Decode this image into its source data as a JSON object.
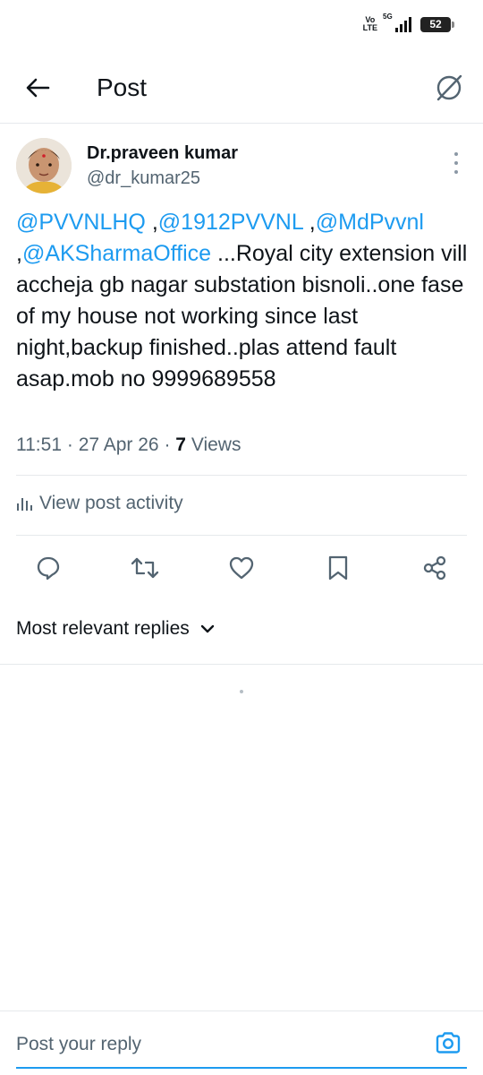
{
  "status_bar": {
    "volte_top": "Vo",
    "volte_bottom": "LTE",
    "network": "5G",
    "battery": "52"
  },
  "header": {
    "title": "Post",
    "back_icon": "arrow-left-icon",
    "grok_icon": "grok-icon"
  },
  "post": {
    "author_name": "Dr.praveen kumar",
    "author_handle": "@dr_kumar25",
    "mentions": [
      "@PVVNLHQ",
      "@1912PVVNL",
      "@MdPvvnl",
      "@AKSharmaOffice"
    ],
    "separators": [
      " ,",
      " ,",
      " ,"
    ],
    "body": " ...Royal city extension vill accheja gb nagar substation bisnoli..one fase of my house not working since last night,backup finished..plas attend fault asap.mob no 9999689558",
    "time": "11:51",
    "date": "27 Apr 26",
    "dot": "·",
    "views_count": "7",
    "views_label": "Views"
  },
  "activity": {
    "label": "View post activity"
  },
  "actions": [
    "reply",
    "repost",
    "like",
    "bookmark",
    "share"
  ],
  "replies": {
    "filter_label": "Most relevant replies"
  },
  "reply_bar": {
    "placeholder": "Post your reply"
  },
  "colors": {
    "accent": "#1d9bf0",
    "text": "#0f1419",
    "secondary": "#536471",
    "divider": "#e6e9ec"
  }
}
